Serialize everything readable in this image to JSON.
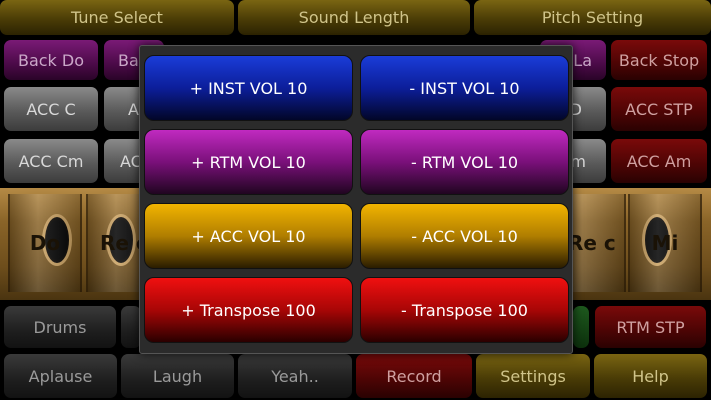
{
  "top_bar": {
    "tune_select": "Tune Select",
    "sound_length": "Sound Length",
    "pitch_setting": "Pitch Setting"
  },
  "row1": {
    "back_do": "Back Do",
    "back_partial": "Ba",
    "back_la_partial": "La",
    "back_stop": "Back Stop"
  },
  "row2": {
    "acc_c": "ACC C",
    "acc_partial": "A",
    "acc_d_partial": "D",
    "acc_stp": "ACC STP"
  },
  "row3": {
    "acc_cm": "ACC Cm",
    "acc_partial": "AC",
    "acc_m_partial": "m",
    "acc_am": "ACC Am"
  },
  "keys": {
    "do": "Do",
    "re_left": "Re c",
    "re_right": "Re c",
    "mi": "Mi"
  },
  "row5": {
    "drums": "Drums",
    "rtm_stp": "RTM STP"
  },
  "bottom_bar": {
    "aplause": "Aplause",
    "laugh": "Laugh",
    "yeah": "Yeah..",
    "record": "Record",
    "settings": "Settings",
    "help": "Help"
  },
  "dialog": {
    "inst_up": "+ INST VOL 10",
    "inst_down": "- INST VOL 10",
    "rtm_up": "+ RTM VOL 10",
    "rtm_down": "- RTM VOL 10",
    "acc_up": "+ ACC VOL 10",
    "acc_down": "- ACC VOL 10",
    "transpose_up": "+ Transpose 100",
    "transpose_down": "- Transpose 100"
  },
  "colors": {
    "olive": "#6a5710",
    "purple": "#6a1566",
    "maroon": "#6a0808",
    "dialog_blue": "#1a3cd8",
    "dialog_magenta": "#c02ac0",
    "dialog_yellow": "#f2b400",
    "dialog_red": "#f01010"
  }
}
